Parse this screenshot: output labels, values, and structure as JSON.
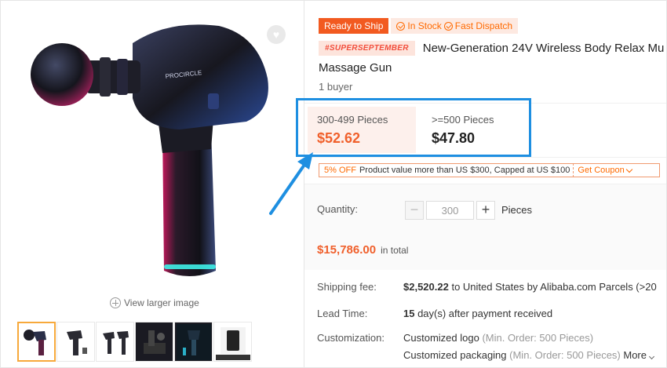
{
  "gallery": {
    "view_larger": "View larger image",
    "product_brand_text": "PROCIRCLE",
    "thumbnails": [
      {
        "name": "thumb-1",
        "active": true
      },
      {
        "name": "thumb-2",
        "active": false
      },
      {
        "name": "thumb-3",
        "active": false
      },
      {
        "name": "thumb-4",
        "active": false
      },
      {
        "name": "thumb-5",
        "active": false
      },
      {
        "name": "thumb-6",
        "active": false
      }
    ]
  },
  "badges": {
    "ready": "Ready to Ship",
    "in_stock": "In Stock",
    "fast_dispatch": "Fast Dispatch"
  },
  "product": {
    "promo_tag": "#SUPERSEPTEMBER",
    "title_line1": "New-Generation 24V Wireless Body Relax Mu",
    "title_line2": "Massage Gun",
    "buyers": "1 buyer"
  },
  "pricing": {
    "tiers": [
      {
        "range": "300-499 Pieces",
        "price": "$52.62"
      },
      {
        "range": ">=500 Pieces",
        "price": "$47.80"
      }
    ]
  },
  "coupon": {
    "discount": "5% OFF",
    "description": "Product value more than US $300, Capped at US $100",
    "action": "Get Coupon"
  },
  "quantity": {
    "label": "Quantity:",
    "value": "300",
    "unit": "Pieces",
    "minus": "−",
    "plus": "+"
  },
  "total": {
    "price": "$15,786.00",
    "label": "in total"
  },
  "shipping": {
    "label": "Shipping fee:",
    "amount": "$2,520.22",
    "detail": " to United States by Alibaba.com Parcels (>20"
  },
  "lead_time": {
    "label": "Lead Time:",
    "days": "15",
    "detail": " day(s) after payment received"
  },
  "customization": {
    "label": "Customization:",
    "logo": "Customized logo",
    "logo_note": " (Min. Order: 500 Pieces)",
    "packaging": "Customized packaging",
    "packaging_note": " (Min. Order: 500 Pieces)",
    "more": "More"
  },
  "colors": {
    "accent_orange": "#f0602c",
    "highlight_blue": "#1e8fe1"
  }
}
